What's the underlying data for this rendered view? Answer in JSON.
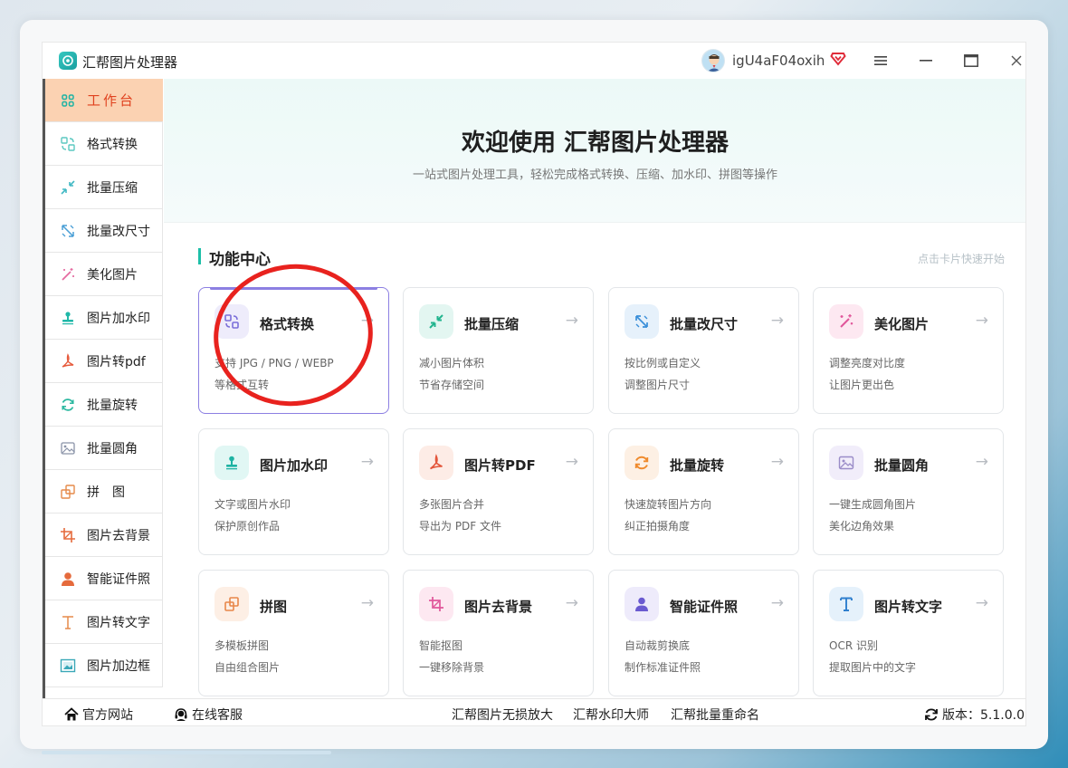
{
  "app": {
    "title": "汇帮图片处理器",
    "username": "igU4aF04oxih"
  },
  "window_controls": {
    "menu": "≡",
    "minimize": "—",
    "maximize": "▭",
    "close": "✕"
  },
  "sidebar": {
    "items": [
      {
        "label": "工作台",
        "icon": "grid-icon",
        "color": "#e0421f"
      },
      {
        "label": "格式转换",
        "icon": "convert-icon",
        "color": "#5bc8c0"
      },
      {
        "label": "批量压缩",
        "icon": "compress-icon",
        "color": "#42b9c4"
      },
      {
        "label": "批量改尺寸",
        "icon": "resize-icon",
        "color": "#4a9fd6"
      },
      {
        "label": "美化图片",
        "icon": "magic-wand-icon",
        "color": "#e56aa0"
      },
      {
        "label": "图片加水印",
        "icon": "stamp-icon",
        "color": "#20b8a8"
      },
      {
        "label": "图片转pdf",
        "icon": "pdf-icon",
        "color": "#e65a3c"
      },
      {
        "label": "批量旋转",
        "icon": "rotate-icon",
        "color": "#2cb8a0"
      },
      {
        "label": "批量圆角",
        "icon": "image-icon",
        "color": "#8a93a8"
      },
      {
        "label": "拼　图",
        "icon": "collage-icon",
        "color": "#e58a4a"
      },
      {
        "label": "图片去背景",
        "icon": "crop-icon",
        "color": "#e56a3c"
      },
      {
        "label": "智能证件照",
        "icon": "person-icon",
        "color": "#e56a3c"
      },
      {
        "label": "图片转文字",
        "icon": "text-icon",
        "color": "#e58a4a"
      },
      {
        "label": "图片加边框",
        "icon": "frame-icon",
        "color": "#3aa8b8"
      }
    ]
  },
  "hero": {
    "title": "欢迎使用 汇帮图片处理器",
    "subtitle": "一站式图片处理工具，轻松完成格式转换、压缩、加水印、拼图等操作"
  },
  "section": {
    "title": "功能中心",
    "hint": "点击卡片快速开始"
  },
  "cards": [
    {
      "title": "格式转换",
      "desc1": "支持 JPG / PNG / WEBP",
      "desc2": "等格式互转",
      "icon": "convert-icon",
      "bg": "#eeecfb",
      "fg": "#7b6fd9"
    },
    {
      "title": "批量压缩",
      "desc1": "减小图片体积",
      "desc2": "节省存储空间",
      "icon": "compress-icon",
      "bg": "#e3f6f1",
      "fg": "#22b48e"
    },
    {
      "title": "批量改尺寸",
      "desc1": "按比例或自定义",
      "desc2": "调整图片尺寸",
      "icon": "resize-icon",
      "bg": "#e6f1fb",
      "fg": "#3a8fd9"
    },
    {
      "title": "美化图片",
      "desc1": "调整亮度对比度",
      "desc2": "让图片更出色",
      "icon": "magic-wand-icon",
      "bg": "#fde8f1",
      "fg": "#e0569a"
    },
    {
      "title": "图片加水印",
      "desc1": "文字或图片水印",
      "desc2": "保护原创作品",
      "icon": "stamp-icon",
      "bg": "#e1f7f4",
      "fg": "#1fb3a3"
    },
    {
      "title": "图片转PDF",
      "desc1": "多张图片合并",
      "desc2": "导出为 PDF 文件",
      "icon": "pdf-icon",
      "bg": "#fdece6",
      "fg": "#e3553a"
    },
    {
      "title": "批量旋转",
      "desc1": "快速旋转图片方向",
      "desc2": "纠正拍摄角度",
      "icon": "rotate-icon",
      "bg": "#fdf0e4",
      "fg": "#ef8a2c"
    },
    {
      "title": "批量圆角",
      "desc1": "一键生成圆角图片",
      "desc2": "美化边角效果",
      "icon": "image-icon",
      "bg": "#f1edfa",
      "fg": "#9a8cc8"
    },
    {
      "title": "拼图",
      "desc1": "多模板拼图",
      "desc2": "自由组合图片",
      "icon": "collage-icon",
      "bg": "#fdefe5",
      "fg": "#e8874a"
    },
    {
      "title": "图片去背景",
      "desc1": "智能抠图",
      "desc2": "一键移除背景",
      "icon": "crop-icon",
      "bg": "#fde8f1",
      "fg": "#e0569a"
    },
    {
      "title": "智能证件照",
      "desc1": "自动裁剪换底",
      "desc2": "制作标准证件照",
      "icon": "person-icon",
      "bg": "#eeebfb",
      "fg": "#6a5ad0"
    },
    {
      "title": "图片转文字",
      "desc1": "OCR 识别",
      "desc2": "提取图片中的文字",
      "icon": "text-icon",
      "bg": "#e5f1fb",
      "fg": "#2e7fce"
    }
  ],
  "footer": {
    "website": "官方网站",
    "service": "在线客服",
    "link1": "汇帮图片无损放大",
    "link2": "汇帮水印大师",
    "link3": "汇帮批量重命名",
    "version": "版本：5.1.0.0"
  }
}
